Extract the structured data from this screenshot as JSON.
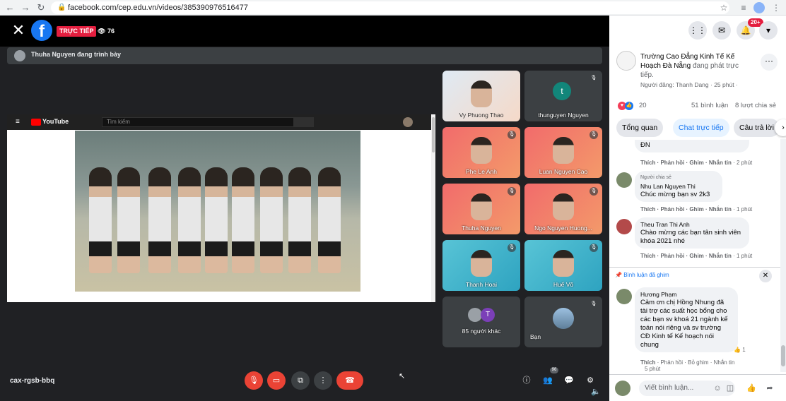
{
  "browser": {
    "url": "facebook.com/cep.edu.vn/videos/385390976516477"
  },
  "video": {
    "live_label": "TRỰC TIẾP",
    "viewers": "76",
    "presenting": "Thuha Nguyen đang trình bày",
    "youtube": {
      "logo": "YouTube",
      "search_placeholder": "Tìm kiếm"
    },
    "participants": [
      {
        "name": "Vy Phuong Thao",
        "style": "photo"
      },
      {
        "name": "thunguyen Nguyen",
        "initial": "t",
        "style": "dark"
      },
      {
        "name": "Phe Le Anh",
        "style": "pink"
      },
      {
        "name": "Luan Nguyen Cao",
        "style": "pink"
      },
      {
        "name": "Thuha Nguyen",
        "style": "pink"
      },
      {
        "name": "Ngo Nguyen Huong...",
        "style": "pink"
      },
      {
        "name": "Thanh Hoai",
        "style": "teal"
      },
      {
        "name": "Huế Võ",
        "style": "teal"
      }
    ],
    "others": {
      "label": "85 người khác",
      "initial": "T"
    },
    "self": {
      "label": "Bạn"
    },
    "meeting_code": "cax-rgsb-bbq",
    "people_count": "96"
  },
  "panel": {
    "notif_count": "20+",
    "page_name": "Trường Cao Đẳng Kinh Tế Kế Hoạch Đà Nẵng",
    "status": "đang phát trực tiếp.",
    "posted_by": "Người đăng: Thanh Dang · 25 phút ·",
    "reactions": "20",
    "comments": "51 bình luận",
    "shares": "8 lượt chia sẻ",
    "tabs": [
      "Tổng quan",
      "Chat trực tiếp",
      "Câu trả lời"
    ],
    "comment_partial": {
      "text": "ĐN",
      "actions": "Thích · Phản hồi · Ghim · Nhắn tin",
      "time": "2 phút"
    },
    "comments_list": [
      {
        "badge": "Người chia sẻ",
        "name": "Nhu Lan Nguyen Thi",
        "text": "Chúc mừng bạn sv 2k3",
        "actions": "Thích · Phản hồi · Ghim · Nhắn tin",
        "time": "1 phút"
      },
      {
        "name": "Theu Tran Thi Anh",
        "text": "Chào mừng các bạn tân sinh viên khóa 2021 nhé",
        "actions": "Thích · Phản hồi · Ghim · Nhắn tin",
        "time": "1 phút"
      }
    ],
    "pinned": {
      "label": "Bình luận đã ghim",
      "name": "Hương Phạm",
      "text": "Cảm ơn chị Hồng Nhung đã tài trợ các suất học bổng cho các bạn sv khoá 21 ngành kế toán nói riêng và sv trường CĐ Kinh tế Kế hoạch nói chung",
      "likes": "1",
      "actions_a": "Thích",
      "actions_b": "Phản hồi · Bỏ ghim · Nhắn tin",
      "time": "5 phút"
    },
    "composer_placeholder": "Viết bình luận..."
  }
}
